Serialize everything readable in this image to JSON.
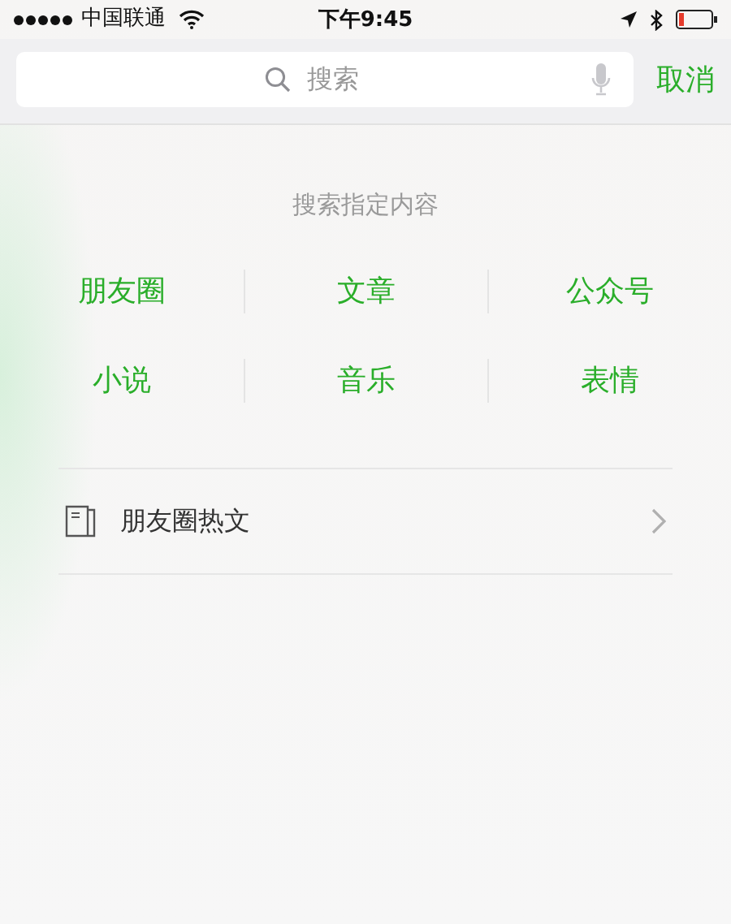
{
  "status_bar": {
    "carrier": "中国联通",
    "time": "下午9:45"
  },
  "search": {
    "placeholder": "搜索",
    "cancel": "取消"
  },
  "section_title": "搜索指定内容",
  "categories": [
    {
      "label": "朋友圈"
    },
    {
      "label": "文章"
    },
    {
      "label": "公众号"
    },
    {
      "label": "小说"
    },
    {
      "label": "音乐"
    },
    {
      "label": "表情"
    }
  ],
  "list": [
    {
      "label": "朋友圈热文"
    }
  ]
}
